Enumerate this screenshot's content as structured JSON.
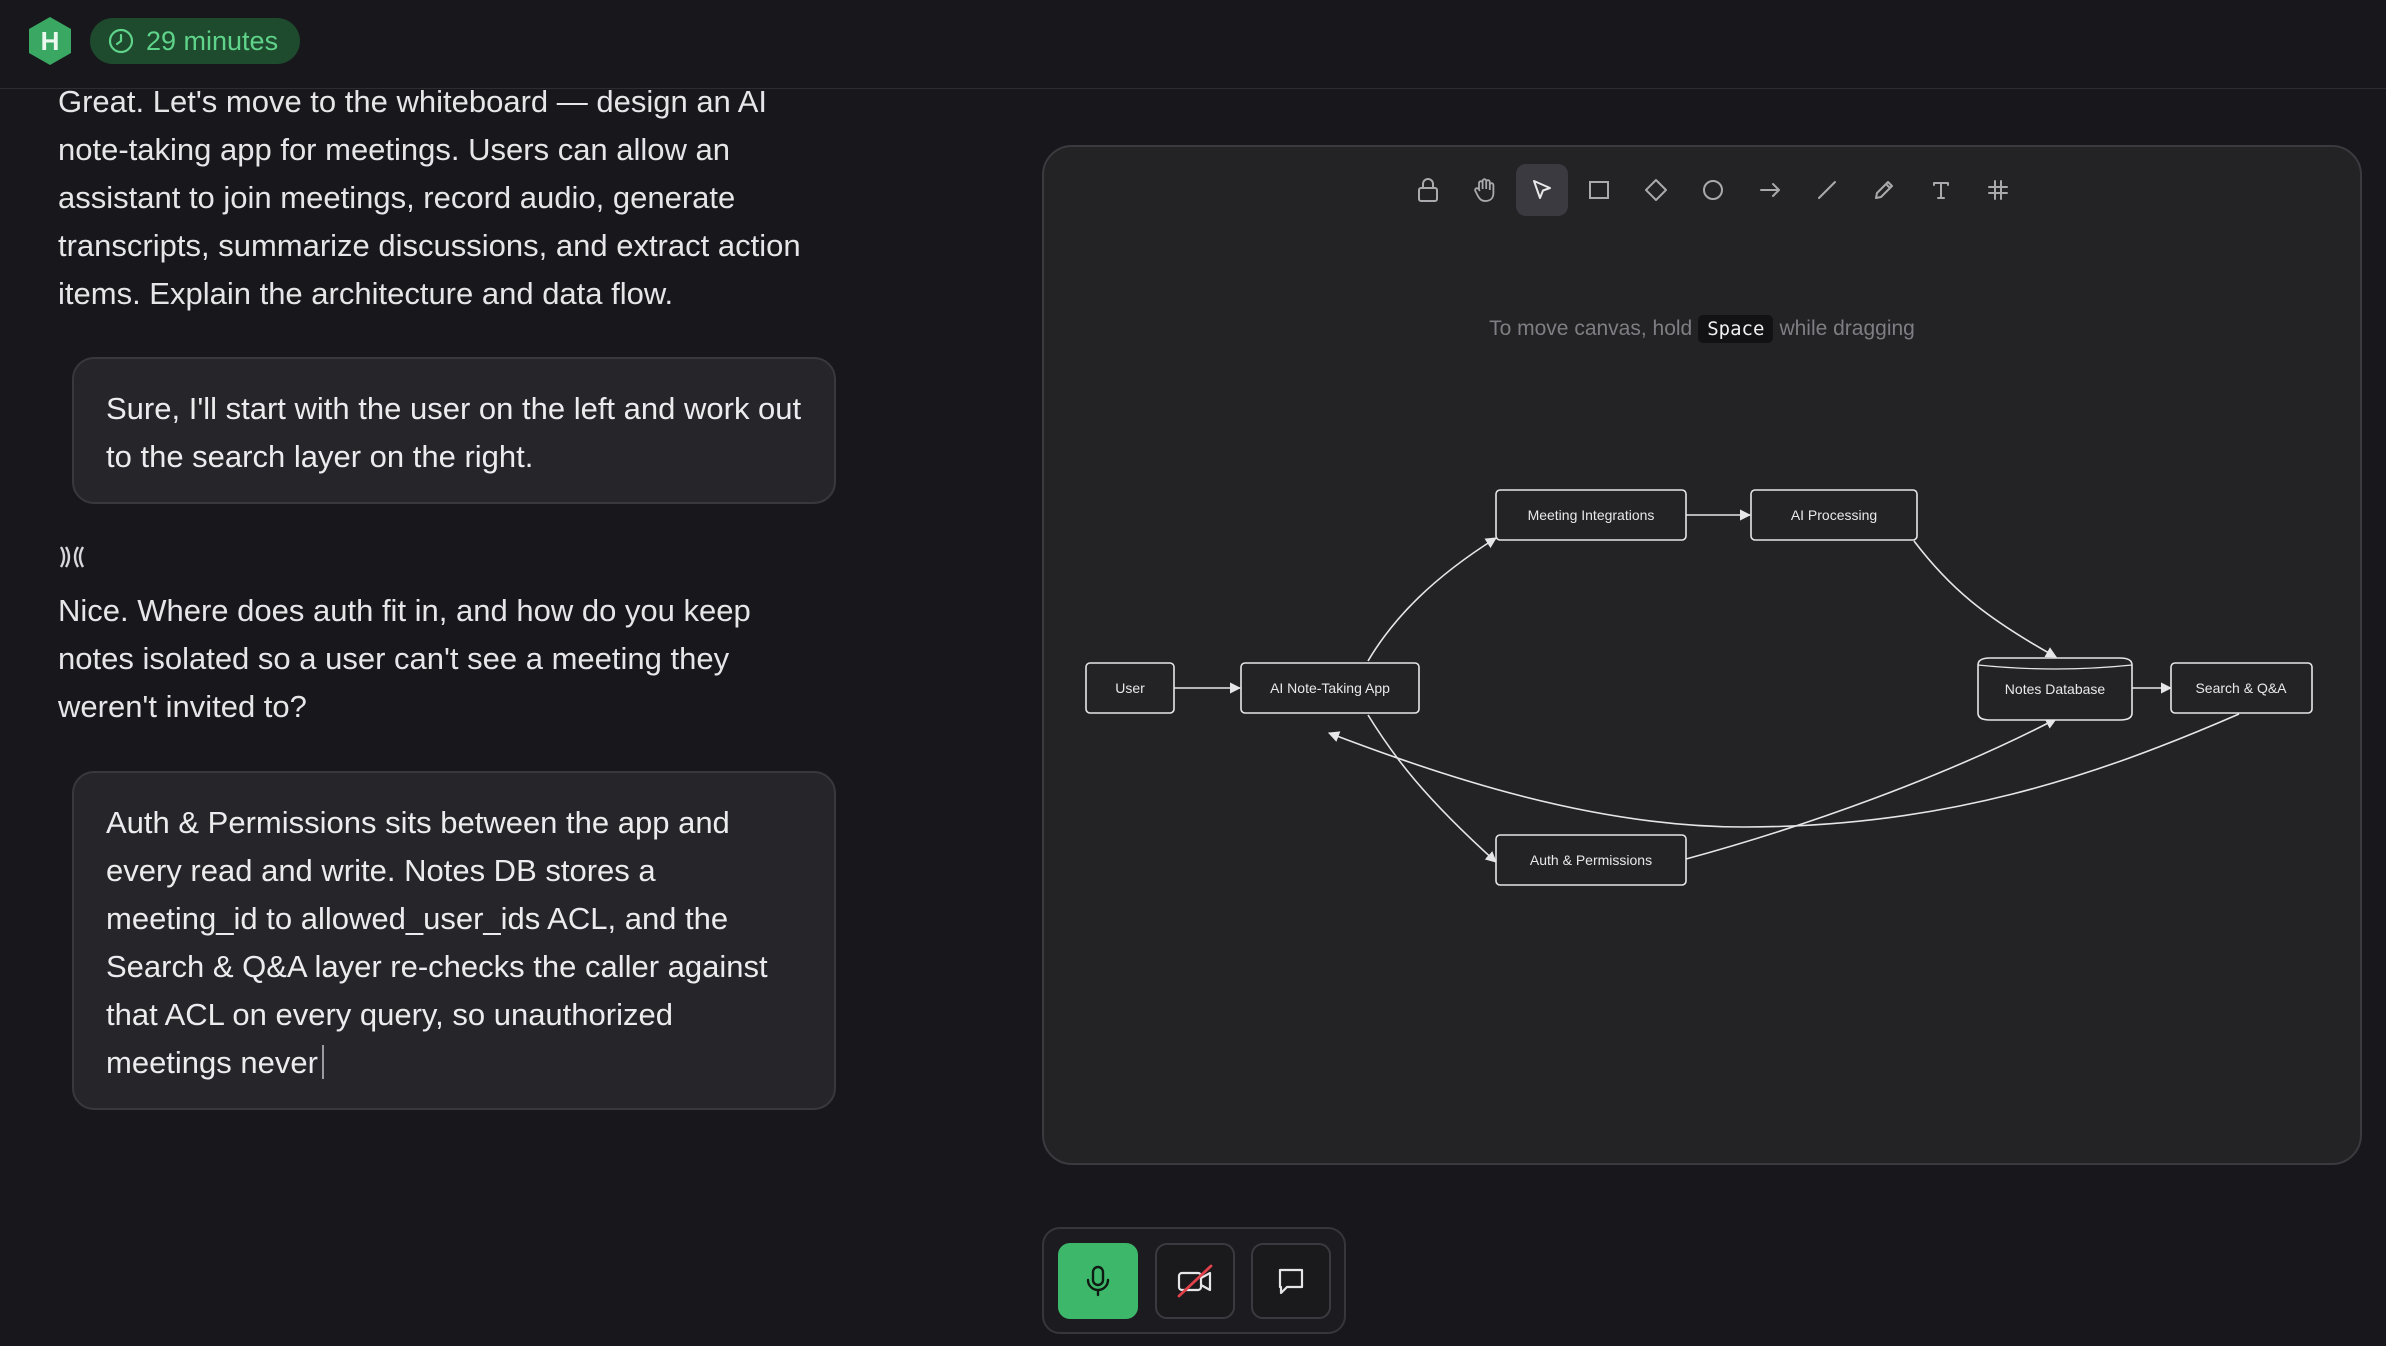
{
  "header": {
    "logo_letter": "H",
    "timer_label": "29 minutes",
    "timer_icon": "clock-icon"
  },
  "conversation": {
    "ai_message_1": "Great. Let's move to the whiteboard — design an AI note-taking app for meetings. Users can allow an assistant to join meetings, record audio, generate transcripts, summarize discussions, and extract action items. Explain the architecture and data flow.",
    "user_message_1": "Sure, I'll start with the user on the left and work out to the search layer on the right.",
    "speaking_indicator_icon": "audio-wave-icon",
    "ai_message_2": "Nice. Where does auth fit in, and how do you keep notes isolated so a user can't see a meeting they weren't invited to?",
    "user_message_2": "Auth & Permissions sits between the app and every read and write. Notes DB stores a meeting_id to allowed_user_ids ACL, and the Search & Q&A layer re-checks the caller against that ACL on every query, so unauthorized meetings never"
  },
  "whiteboard": {
    "tools": [
      {
        "name": "lock-icon"
      },
      {
        "name": "hand-icon"
      },
      {
        "name": "pointer-icon",
        "active": true
      },
      {
        "name": "rectangle-icon"
      },
      {
        "name": "diamond-icon"
      },
      {
        "name": "ellipse-icon"
      },
      {
        "name": "arrow-icon"
      },
      {
        "name": "line-icon"
      },
      {
        "name": "pencil-icon"
      },
      {
        "name": "text-icon"
      },
      {
        "name": "grid-icon"
      }
    ],
    "hint_prefix": "To move canvas, hold",
    "hint_key": "Space",
    "hint_suffix": "while dragging",
    "nodes": {
      "user": "User",
      "app": "AI Note-Taking App",
      "integrations": "Meeting Integrations",
      "ai": "AI Processing",
      "db": "Notes Database",
      "search": "Search & Q&A",
      "auth": "Auth & Permissions"
    }
  },
  "controls": {
    "mic": "microphone-icon",
    "camera": "camera-off-icon",
    "chat": "chat-bubble-icon"
  },
  "colors": {
    "background": "#18181c",
    "accent_green": "#3db86b",
    "timer_bg": "#1e4a2e",
    "timer_text": "#5fd38a",
    "camera_off_red": "#e0414b"
  }
}
